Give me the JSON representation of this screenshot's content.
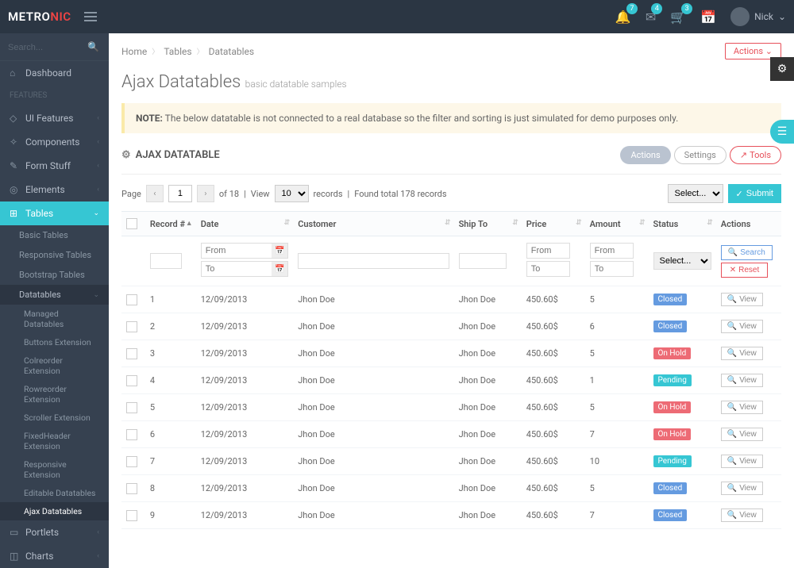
{
  "brand": {
    "part1": "METRO",
    "part2": "NIC"
  },
  "topIcons": [
    {
      "name": "bell-icon",
      "glyph": "🔔",
      "badge": "7"
    },
    {
      "name": "envelope-icon",
      "glyph": "✉",
      "badge": "4"
    },
    {
      "name": "cart-icon",
      "glyph": "🛒",
      "badge": "3"
    },
    {
      "name": "calendar-icon",
      "glyph": "📅",
      "badge": ""
    }
  ],
  "user": {
    "name": "Nick",
    "chevron": "⌄"
  },
  "search": {
    "placeholder": "Search..."
  },
  "nav": {
    "dashboard": "Dashboard",
    "featuresHeading": "FEATURES",
    "items": [
      {
        "icon": "◇",
        "label": "UI Features"
      },
      {
        "icon": "✧",
        "label": "Components"
      },
      {
        "icon": "✎",
        "label": "Form Stuff"
      },
      {
        "icon": "◎",
        "label": "Elements"
      }
    ],
    "tables": {
      "icon": "⊞",
      "label": "Tables"
    },
    "subTables": [
      "Basic Tables",
      "Responsive Tables",
      "Bootstrap Tables"
    ],
    "datatables": "Datatables",
    "datatablesChildren": [
      "Managed Datatables",
      "Buttons Extension",
      "Colreorder Extension",
      "Rowreorder Extension",
      "Scroller Extension",
      "FixedHeader Extension",
      "Responsive Extension",
      "Editable Datatables",
      "Ajax Datatables"
    ],
    "portlets": {
      "icon": "▭",
      "label": "Portlets"
    },
    "charts": {
      "icon": "📊",
      "label": "Charts"
    }
  },
  "breadcrumb": {
    "home": "Home",
    "tables": "Tables",
    "current": "Datatables",
    "actions": "Actions ⌄"
  },
  "page": {
    "title": "Ajax Datatables",
    "subtitle": "basic datatable samples"
  },
  "note": {
    "label": "NOTE:",
    "text": "The below datatable is not connected to a real database so the filter and sorting is just simulated for demo purposes only."
  },
  "portlet": {
    "title": "AJAX DATATABLE",
    "actions": "Actions",
    "settings": "Settings",
    "tools": "Tools"
  },
  "pager": {
    "pageLabel": "Page",
    "current": "1",
    "ofLabel": "of 18",
    "viewLabel": "View",
    "perPage": "10",
    "recordsLabel": "records",
    "foundLabel": "Found total 178 records",
    "select": "Select...",
    "submit": "Submit"
  },
  "columns": {
    "record": "Record #",
    "date": "Date",
    "customer": "Customer",
    "shipTo": "Ship To",
    "price": "Price",
    "amount": "Amount",
    "status": "Status",
    "actions": "Actions"
  },
  "filters": {
    "from": "From",
    "to": "To",
    "select": "Select...",
    "search": "Search",
    "reset": "Reset"
  },
  "rows": [
    {
      "rec": "1",
      "date": "12/09/2013",
      "cust": "Jhon Doe",
      "ship": "Jhon Doe",
      "price": "450.60$",
      "amt": "5",
      "status": "Closed",
      "statusClass": "st-closed"
    },
    {
      "rec": "2",
      "date": "12/09/2013",
      "cust": "Jhon Doe",
      "ship": "Jhon Doe",
      "price": "450.60$",
      "amt": "6",
      "status": "Closed",
      "statusClass": "st-closed"
    },
    {
      "rec": "3",
      "date": "12/09/2013",
      "cust": "Jhon Doe",
      "ship": "Jhon Doe",
      "price": "450.60$",
      "amt": "5",
      "status": "On Hold",
      "statusClass": "st-onhold"
    },
    {
      "rec": "4",
      "date": "12/09/2013",
      "cust": "Jhon Doe",
      "ship": "Jhon Doe",
      "price": "450.60$",
      "amt": "1",
      "status": "Pending",
      "statusClass": "st-pending"
    },
    {
      "rec": "5",
      "date": "12/09/2013",
      "cust": "Jhon Doe",
      "ship": "Jhon Doe",
      "price": "450.60$",
      "amt": "5",
      "status": "On Hold",
      "statusClass": "st-onhold"
    },
    {
      "rec": "6",
      "date": "12/09/2013",
      "cust": "Jhon Doe",
      "ship": "Jhon Doe",
      "price": "450.60$",
      "amt": "7",
      "status": "On Hold",
      "statusClass": "st-onhold"
    },
    {
      "rec": "7",
      "date": "12/09/2013",
      "cust": "Jhon Doe",
      "ship": "Jhon Doe",
      "price": "450.60$",
      "amt": "10",
      "status": "Pending",
      "statusClass": "st-pending"
    },
    {
      "rec": "8",
      "date": "12/09/2013",
      "cust": "Jhon Doe",
      "ship": "Jhon Doe",
      "price": "450.60$",
      "amt": "5",
      "status": "Closed",
      "statusClass": "st-closed"
    },
    {
      "rec": "9",
      "date": "12/09/2013",
      "cust": "Jhon Doe",
      "ship": "Jhon Doe",
      "price": "450.60$",
      "amt": "7",
      "status": "Closed",
      "statusClass": "st-closed"
    }
  ],
  "viewLabel": "View"
}
